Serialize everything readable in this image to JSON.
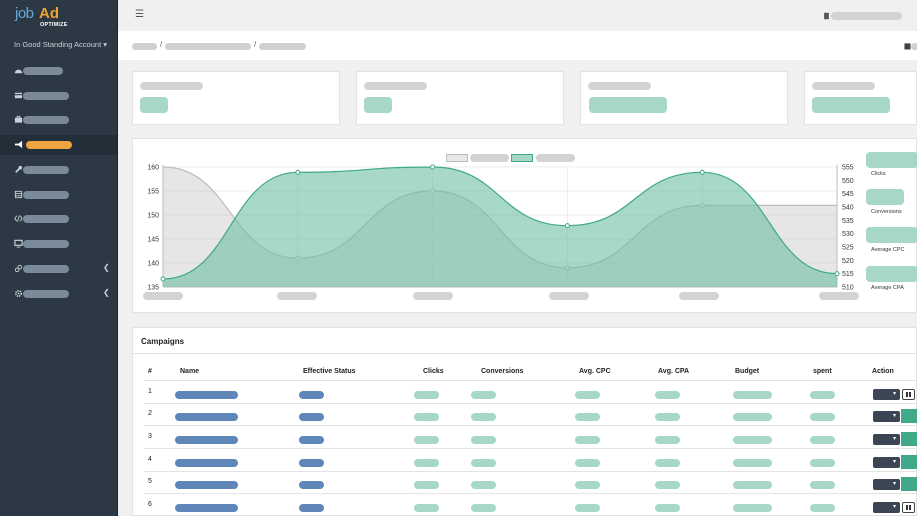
{
  "sidebar": {
    "account": "In Good Standing Account",
    "logo": {
      "job": "job",
      "ad": "Ad",
      "optimize": "OPTIMIZE"
    }
  },
  "campaigns_title": "Campaigns",
  "table": {
    "headers": [
      "#",
      "Name",
      "Effective Status",
      "Clicks",
      "Conversions",
      "Avg. CPC",
      "Avg. CPA",
      "Budget",
      "spent",
      "Action"
    ],
    "rows": [
      "1",
      "2",
      "3",
      "4",
      "5",
      "6"
    ]
  },
  "stats": [
    "Clicks",
    "Conversions",
    "Average CPC",
    "Average CPA"
  ],
  "chart_data": {
    "type": "area",
    "y_left_ticks": [
      "160",
      "155",
      "150",
      "145",
      "140",
      "135"
    ],
    "y_right_ticks": [
      "555",
      "550",
      "545",
      "540",
      "535",
      "530",
      "525",
      "520",
      "515",
      "510"
    ],
    "ylim_left": [
      135,
      160
    ],
    "ylim_right": [
      510,
      555
    ],
    "x": [
      0,
      1,
      2,
      3,
      4,
      5
    ],
    "series": [
      {
        "values": [
          160,
          141,
          155,
          139,
          152,
          152
        ],
        "axis": "left",
        "color": "#bcbcbc"
      },
      {
        "values": [
          513,
          553,
          555,
          533,
          553,
          515
        ],
        "axis": "right",
        "color": "#3fa98a"
      }
    ],
    "grid": true
  }
}
